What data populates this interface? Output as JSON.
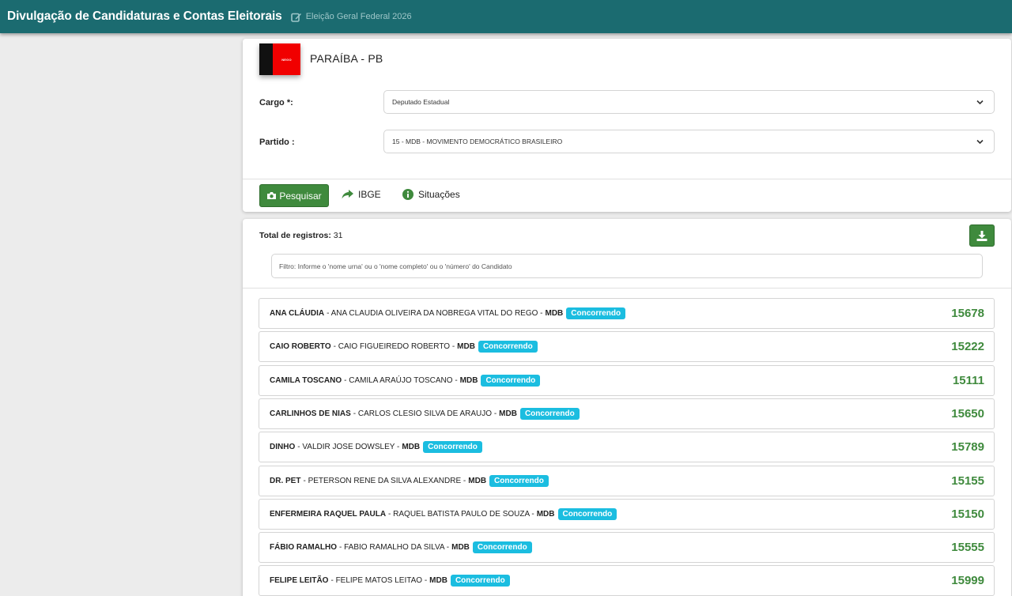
{
  "header": {
    "title": "Divulgação de Candidaturas e Contas Eleitorais",
    "election": "Eleição Geral Federal 2026"
  },
  "state": {
    "name": "PARAÍBA - PB",
    "flag_text": "NEGO",
    "flag_colors": [
      "#111111",
      "#f10000"
    ]
  },
  "filters": {
    "cargo_label": "Cargo *:",
    "cargo_value": "Deputado Estadual",
    "partido_label": "Partido :",
    "partido_value": "15 - MDB - MOVIMENTO DEMOCRÁTICO BRASILEIRO"
  },
  "actions": {
    "search_label": "Pesquisar",
    "ibge_label": "IBGE",
    "situacoes_label": "Situações"
  },
  "results": {
    "total_label": "Total de registros:",
    "total_value": "31",
    "filter_placeholder": "Filtro: Informe o 'nome urna' ou o 'nome completo' ou o 'número' do Candidato",
    "candidates": [
      {
        "nome_urna": "ANA CLÁUDIA",
        "nome_completo": "ANA CLAUDIA OLIVEIRA DA NOBREGA VITAL DO REGO",
        "partido": "MDB",
        "situacao": "Concorrendo",
        "numero": "15678"
      },
      {
        "nome_urna": "CAIO ROBERTO",
        "nome_completo": "CAIO FIGUEIREDO ROBERTO",
        "partido": "MDB",
        "situacao": "Concorrendo",
        "numero": "15222"
      },
      {
        "nome_urna": "CAMILA TOSCANO",
        "nome_completo": "CAMILA ARAÚJO TOSCANO",
        "partido": "MDB",
        "situacao": "Concorrendo",
        "numero": "15111"
      },
      {
        "nome_urna": "CARLINHOS DE NIAS",
        "nome_completo": "CARLOS CLESIO SILVA DE ARAUJO",
        "partido": "MDB",
        "situacao": "Concorrendo",
        "numero": "15650"
      },
      {
        "nome_urna": "DINHO",
        "nome_completo": "VALDIR JOSE DOWSLEY",
        "partido": "MDB",
        "situacao": "Concorrendo",
        "numero": "15789"
      },
      {
        "nome_urna": "DR. PET",
        "nome_completo": "PETERSON RENE DA SILVA ALEXANDRE",
        "partido": "MDB",
        "situacao": "Concorrendo",
        "numero": "15155"
      },
      {
        "nome_urna": "ENFERMEIRA RAQUEL PAULA",
        "nome_completo": "RAQUEL BATISTA PAULO DE SOUZA",
        "partido": "MDB",
        "situacao": "Concorrendo",
        "numero": "15150"
      },
      {
        "nome_urna": "FÁBIO RAMALHO",
        "nome_completo": "FABIO RAMALHO DA SILVA",
        "partido": "MDB",
        "situacao": "Concorrendo",
        "numero": "15555"
      },
      {
        "nome_urna": "FELIPE LEITÃO",
        "nome_completo": "FELIPE MATOS LEITAO",
        "partido": "MDB",
        "situacao": "Concorrendo",
        "numero": "15999"
      }
    ]
  },
  "colors": {
    "header_bg": "#1b6b70",
    "accent_green": "#3f8a3d",
    "badge_cyan": "#1bbde0"
  }
}
